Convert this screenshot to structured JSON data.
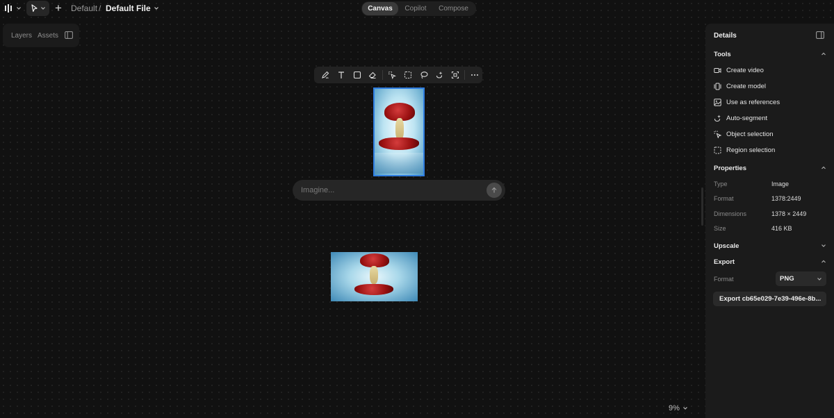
{
  "topbar": {
    "logo_icon": "logo-icon",
    "tool_icon": "select-cursor-icon",
    "add_icon": "plus-icon",
    "breadcrumb_project": "Default",
    "breadcrumb_separator": "/",
    "breadcrumb_file": "Default File",
    "modes": [
      {
        "label": "Canvas",
        "active": true
      },
      {
        "label": "Copilot",
        "active": false
      },
      {
        "label": "Compose",
        "active": false
      }
    ]
  },
  "left_panel": {
    "tabs": [
      "Layers",
      "Assets"
    ]
  },
  "canvas_toolbar": {
    "tools": [
      "pen-icon",
      "text-icon",
      "rectangle-icon",
      "eraser-icon",
      "object-select-icon",
      "region-select-icon",
      "lasso-icon",
      "auto-segment-icon",
      "focus-icon",
      "more-icon"
    ]
  },
  "prompt": {
    "placeholder": "Imagine..."
  },
  "zoom": {
    "label": "9%"
  },
  "details": {
    "title": "Details",
    "tools": {
      "heading": "Tools",
      "items": [
        {
          "label": "Create video",
          "icon": "video-icon"
        },
        {
          "label": "Create model",
          "icon": "model-icon"
        },
        {
          "label": "Use as references",
          "icon": "image-icon"
        },
        {
          "label": "Auto-segment",
          "icon": "sparkle-icon"
        },
        {
          "label": "Object selection",
          "icon": "object-select-icon"
        },
        {
          "label": "Region selection",
          "icon": "region-select-icon"
        }
      ]
    },
    "properties": {
      "heading": "Properties",
      "rows": [
        {
          "key": "Type",
          "value": "Image"
        },
        {
          "key": "Format",
          "value": "1378:2449"
        },
        {
          "key": "Dimensions",
          "value": "1378 × 2449"
        },
        {
          "key": "Size",
          "value": "416 KB"
        }
      ]
    },
    "upscale": {
      "heading": "Upscale"
    },
    "export": {
      "heading": "Export",
      "format_label": "Format",
      "format_value": "PNG",
      "button_label": "Export cb65e029-7e39-496e-8b..."
    }
  },
  "colors": {
    "background": "#111111",
    "panel": "#1b1b1b",
    "selection": "#2f7de1"
  }
}
